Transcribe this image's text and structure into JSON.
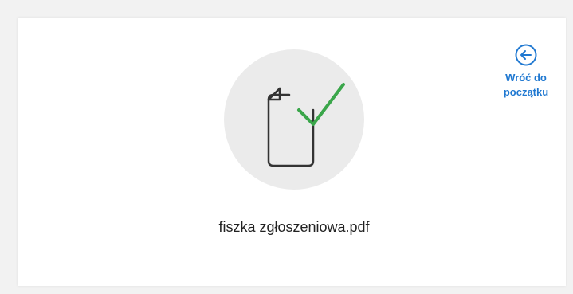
{
  "file": {
    "name": "fiszka zgłoszeniowa.pdf",
    "status_icon": "file-check-icon"
  },
  "back": {
    "icon": "arrow-left-circle-icon",
    "label_line1": "Wróć do",
    "label_line2": "początku"
  },
  "colors": {
    "accent": "#1f78d1",
    "check": "#3aa64a",
    "circle_bg": "#ebebeb",
    "page_bg": "#f2f2f2"
  }
}
